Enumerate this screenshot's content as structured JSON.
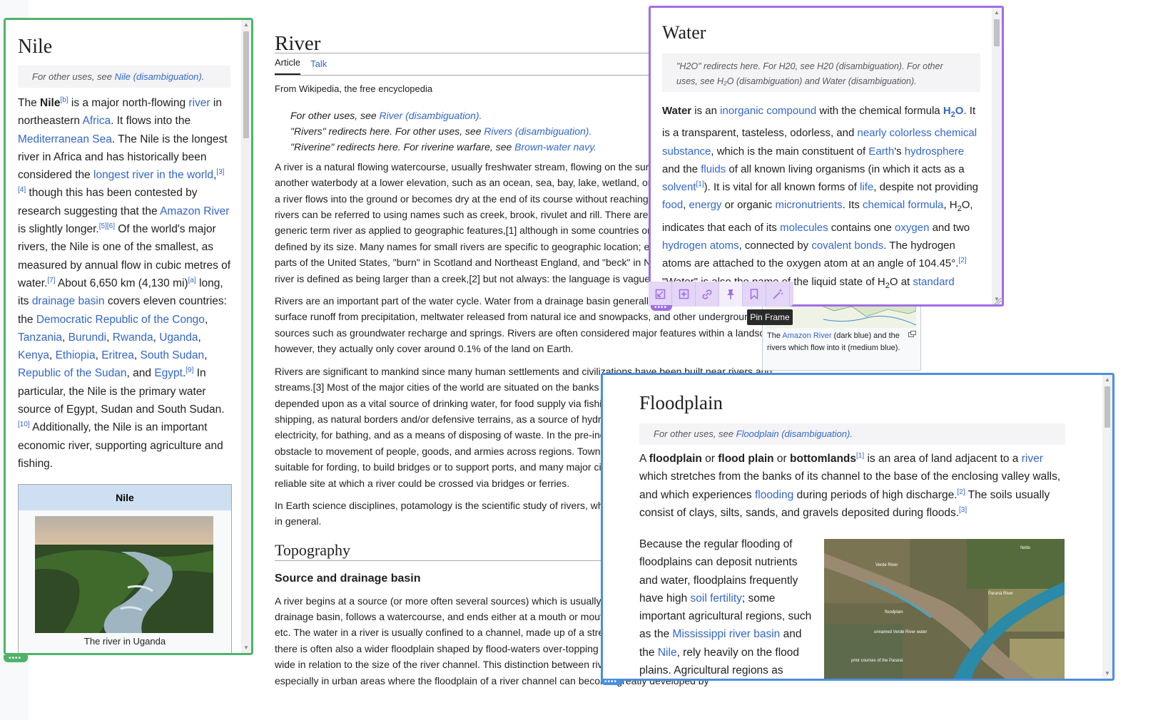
{
  "river": {
    "title": "River",
    "tab_article": "Article",
    "tab_talk": "Talk",
    "tagline": "From Wikipedia, the free encyclopedia",
    "hatnote_1_pre": "For other uses, see ",
    "hatnote_1_link": "River (disambiguation).",
    "hatnote_2_pre": "\"Rivers\" redirects here. For other uses, see ",
    "hatnote_2_link": "Rivers (disambiguation).",
    "hatnote_3_pre": "\"Riverine\" redirects here. For riverine warfare, see ",
    "hatnote_3_link": "Brown-water navy.",
    "para1": "A river is a natural flowing watercourse, usually freshwater stream, flowing on the surface or inside caves towards another waterbody at a lower elevation, such as an ocean, sea, bay, lake, wetland, or another river. In some cases, a river flows into the ground or becomes dry at the end of its course without reaching another body of water. Small rivers can be referred to using names such as creek, brook, rivulet and rill. There are no official definitions for the generic term river as applied to geographic features,[1] although in some countries or communities a stream is defined by its size. Many names for small rivers are specific to geographic location; examples are \"run\" in some parts of the United States, \"burn\" in Scotland and Northeast England, and \"beck\" in Northern England. Sometimes a river is defined as being larger than a creek,[2] but not always: the language is vague.[1]",
    "para2": "Rivers are an important part of the water cycle. Water from a drainage basin generally collects into a river through surface runoff from precipitation, meltwater released from natural ice and snowpacks, and other underground sources such as groundwater recharge and springs. Rivers are often considered major features within a landscape; however, they actually only cover around 0.1% of the land on Earth.",
    "para3": "Rivers are significant to mankind since many human settlements and civilizations have been built near rivers and streams.[3] Most of the major cities of the world are situated on the banks of rivers, as rivers have been and still are depended upon as a vital source of drinking water, for food supply via fishing and agriculture, for transportation and shipping, as natural borders and/or defensive terrains, as a source of hydropower to drive machinery and generate electricity, for bathing, and as a means of disposing of waste. In the pre-industrial era, rivers have been a major obstacle to movement of people, goods, and armies across regions. Towns often developed where the terrain was suitable for fording, to build bridges or to support ports, and many major cities still sit at the narrowest and most reliable site at which a river could be crossed via bridges or ferries.",
    "para4": "In Earth science disciplines, potamology is the scientific study of rivers, while limnology is the study of inland waters in general.",
    "h2_topography": "Topography",
    "h3_source": "Source and drainage basin",
    "para5": "A river begins at a source (or more often several sources) which is usually a watershed, drains all the streams in its drainage basin, follows a watercourse, and ends either at a mouth or mouths which could be a confluence, delta, etc. The water in a river is usually confined to a channel, made up of a stream bed between banks. In larger rivers there is often also a wider floodplain shaped by flood-waters over-topping the channel. Floodplains may be very wide in relation to the size of the river channel. This distinction between river channel and floodplain can be blurred, especially in urban areas where the floodplain of a river channel can become greatly developed by",
    "amazon_caption_pre": "The ",
    "amazon_caption_link": "Amazon River",
    "amazon_caption_post": " (dark blue) and the rivers which flow into it (medium blue)."
  },
  "nile_frame": {
    "title": "Nile",
    "hatnote_pre": "For other uses, see ",
    "hatnote_link": "Nile (disambiguation).",
    "infobox_title": "Nile",
    "photo_caption": "The river in Uganda",
    "border_color": "#4fb36b"
  },
  "water_frame": {
    "title": "Water",
    "hatnote": "\"H2O\" redirects here. For H20, see H20 (disambiguation). For other uses, see H₂O (disambiguation) and Water (disambiguation).",
    "border_color": "#a06ee6",
    "toolbar_tooltip": "Pin Frame",
    "toolbar_icons": [
      "resize-frame-icon",
      "add-frame-icon",
      "link-icon",
      "pin-icon",
      "bookmark-icon",
      "magic-wand-icon"
    ]
  },
  "flood_frame": {
    "title": "Floodplain",
    "hatnote_pre": "For other uses, see ",
    "hatnote_link": "Floodplain (disambiguation).",
    "border_color": "#4b8fe0",
    "sat_labels": [
      "fields",
      "Verde River",
      "Paraná River",
      "floodplain",
      "unnamed Verde River water",
      "prior courses of the Paraná"
    ]
  }
}
